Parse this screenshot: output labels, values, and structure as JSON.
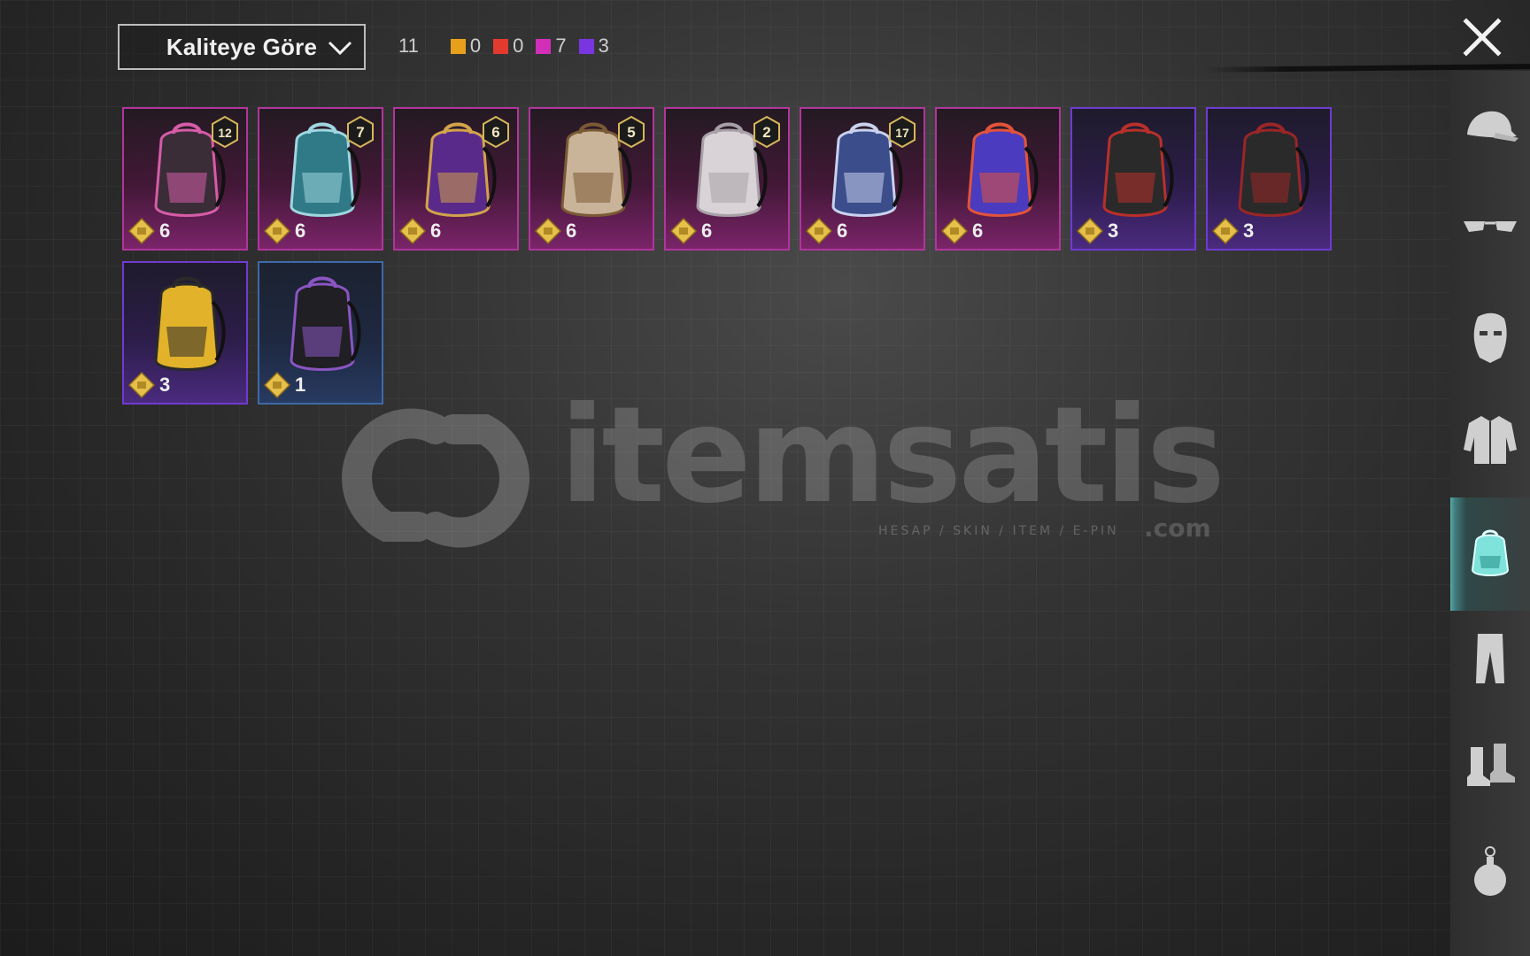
{
  "header": {
    "sort_dropdown": {
      "selected": "Kaliteye Göre",
      "icon": "chevron-down-icon"
    },
    "total_count": "11",
    "rarity_counts": [
      {
        "color": "#e7a01c",
        "count": "0"
      },
      {
        "color": "#e23a2e",
        "count": "0"
      },
      {
        "color": "#d12fb8",
        "count": "7"
      },
      {
        "color": "#7a35e0",
        "count": "3"
      }
    ],
    "close_icon": "close-icon"
  },
  "items": [
    {
      "name": "backpack-pink-bunny",
      "rarity": "pink",
      "level": "12",
      "cost": "6"
    },
    {
      "name": "backpack-teal-astronaut",
      "rarity": "pink",
      "level": "7",
      "cost": "6"
    },
    {
      "name": "backpack-purple-mirror",
      "rarity": "pink",
      "level": "6",
      "cost": "6"
    },
    {
      "name": "backpack-ornate-gold",
      "rarity": "pink",
      "level": "5",
      "cost": "6"
    },
    {
      "name": "backpack-spiked-white",
      "rarity": "pink",
      "level": "2",
      "cost": "6"
    },
    {
      "name": "backpack-blue-monster",
      "rarity": "pink",
      "level": "17",
      "cost": "6"
    },
    {
      "name": "backpack-clown",
      "rarity": "pink",
      "level": "",
      "cost": "6"
    },
    {
      "name": "backpack-red-black-1",
      "rarity": "purple",
      "level": "",
      "cost": "3"
    },
    {
      "name": "backpack-red-black-2",
      "rarity": "purple",
      "level": "",
      "cost": "3"
    },
    {
      "name": "backpack-yellow-emoji",
      "rarity": "purple",
      "level": "",
      "cost": "3"
    },
    {
      "name": "backpack-black-graffiti",
      "rarity": "blue",
      "level": "",
      "cost": "1"
    }
  ],
  "sidebar": {
    "items": [
      {
        "icon": "cap-icon",
        "active": false
      },
      {
        "icon": "glasses-icon",
        "active": false
      },
      {
        "icon": "mask-icon",
        "active": false
      },
      {
        "icon": "jacket-icon",
        "active": false
      },
      {
        "icon": "backpack-icon",
        "active": true
      },
      {
        "icon": "pants-icon",
        "active": false
      },
      {
        "icon": "boots-icon",
        "active": false
      },
      {
        "icon": "grenade-icon",
        "active": false
      }
    ]
  },
  "watermark": {
    "brand": "itemsatis",
    "tagline": "HESAP / SKIN / ITEM / E-PIN",
    "suffix": ".com"
  }
}
